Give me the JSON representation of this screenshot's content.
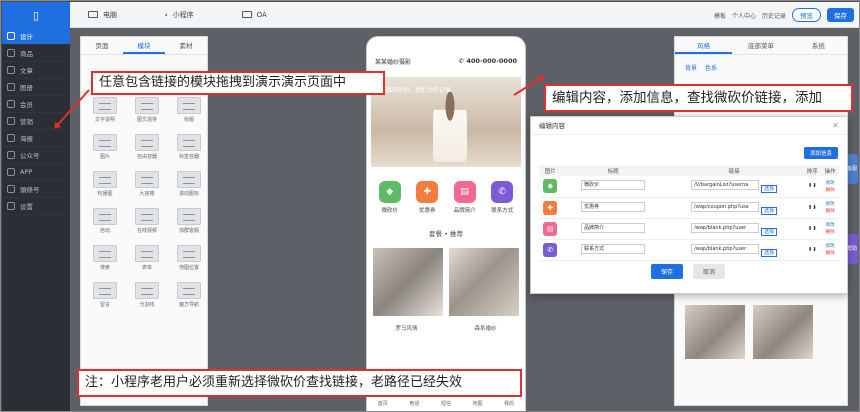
{
  "nav": {
    "items": [
      {
        "label": "设计",
        "active": true
      },
      {
        "label": "商品"
      },
      {
        "label": "文章"
      },
      {
        "label": "图册"
      },
      {
        "label": "会员"
      },
      {
        "label": "营销"
      },
      {
        "label": "海报"
      },
      {
        "label": "公众号"
      },
      {
        "label": "APP"
      },
      {
        "label": "頭條号"
      },
      {
        "label": "设置"
      }
    ]
  },
  "topbar": {
    "tabs": [
      "电脑",
      "小程序",
      "OA"
    ],
    "links": [
      "模板",
      "个人中心",
      "历史记录"
    ],
    "preview_label": "预览",
    "save_label": "保存"
  },
  "component_panel": {
    "tabs": [
      "页面",
      "模块",
      "素材"
    ],
    "tiles": [
      "文字说明",
      "图文混排",
      "标题",
      "图片",
      "自由容器",
      "标签容器",
      "轮播图",
      "九宫格",
      "滚动图标",
      "自动",
      "在线视频",
      "加群客服",
      "搜索",
      "表单",
      "地图位置",
      "留言",
      "分割线",
      "魔方导航"
    ]
  },
  "phone": {
    "brand": "某某婚纱摄影",
    "tel": "400-000-0000",
    "banner_caption": "幸福的时刻，我们为你记录",
    "icons": [
      {
        "label": "微砍价",
        "color": "#5dbb63"
      },
      {
        "label": "优惠券",
        "color": "#f47c3c"
      },
      {
        "label": "品牌简介",
        "color": "#f06a8f"
      },
      {
        "label": "联系方式",
        "color": "#7b5bd6"
      }
    ],
    "section_title": "套餐 • 推荐",
    "photo_captions": [
      "罗马风情",
      "森系婚纱"
    ],
    "footer": [
      "首页",
      "电话",
      "短信",
      "地图",
      "我的"
    ]
  },
  "right_panel": {
    "tabs": [
      "风格",
      "底部菜单",
      "系统"
    ],
    "sub": [
      "背景",
      "色系"
    ],
    "side_tabs": [
      "客服",
      "帮助"
    ]
  },
  "modal": {
    "title": "编辑内容",
    "add_label": "添加信息",
    "headers": [
      "图片",
      "标题",
      "链接",
      "排序",
      "操作"
    ],
    "rows": [
      {
        "title": "微砍价",
        "link": "/V/bargainList?userna",
        "color": "#5dbb63"
      },
      {
        "title": "优惠券",
        "link": "/wap/coupon.php?use",
        "color": "#f47c3c"
      },
      {
        "title": "品牌简介",
        "link": "/wap/blank.php?user",
        "color": "#f06a8f"
      },
      {
        "title": "联系方式",
        "link": "/wap/blank.php?user",
        "color": "#7b5bd6"
      }
    ],
    "select_link": "选择",
    "edit": "修改",
    "delete": "删除",
    "ok_label": "保存",
    "cancel_label": "取消"
  },
  "annotations": {
    "drag": "任意包含链接的模块拖拽到演示演示页面中",
    "edit": "编辑内容，添加信息，查找微砍价链接，添加",
    "note": "注：小程序老用户必须重新选择微砍价查找链接，老路径已经失效"
  }
}
